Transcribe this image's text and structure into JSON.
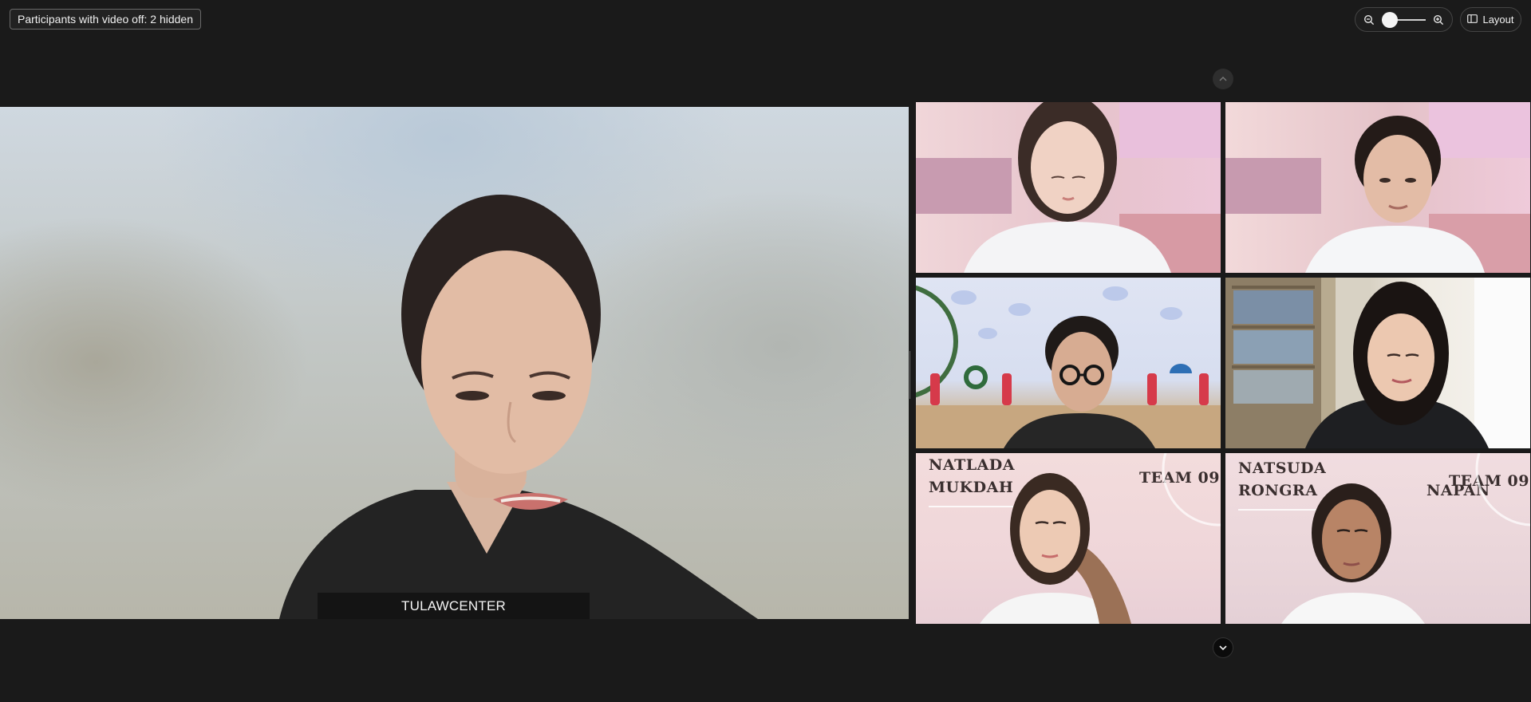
{
  "top_bar": {
    "hidden_participants": "Participants with video off: 2 hidden",
    "zoom": {
      "level": 0.0
    },
    "layout_label": "Layout"
  },
  "main_video": {
    "name": "TULAWCENTER"
  },
  "gallery": {
    "tiles": [
      {
        "id": "tile-1"
      },
      {
        "id": "tile-2"
      },
      {
        "id": "tile-3"
      },
      {
        "id": "tile-4"
      },
      {
        "id": "tile-5",
        "background_lines": [
          "NATLADA",
          "MUKDAH"
        ],
        "background_team": "TEAM 09"
      },
      {
        "id": "tile-6",
        "background_lines": [
          "NATSUDA",
          "RONGRA",
          "NAPAN"
        ],
        "background_team": "TEAM 09"
      }
    ]
  },
  "icons": {
    "zoom_out": "zoom-out-icon",
    "zoom_in": "zoom-in-icon",
    "layout": "layout-icon",
    "scroll_up": "chevron-up-icon",
    "scroll_down": "chevron-down-icon"
  }
}
